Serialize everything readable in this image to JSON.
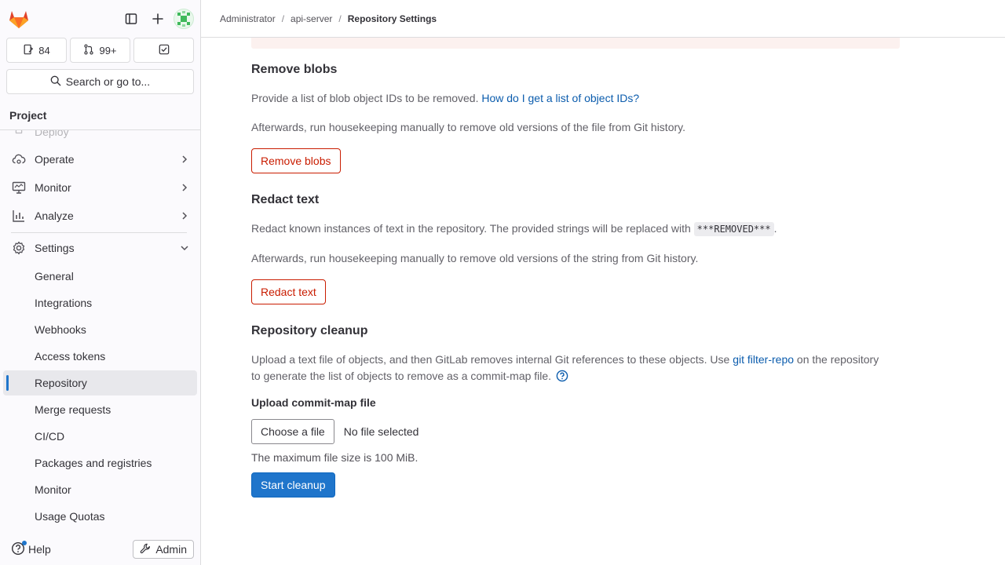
{
  "sidebar": {
    "counters": [
      {
        "icon": "issues-icon",
        "value": "84"
      },
      {
        "icon": "merge-request-icon",
        "value": "99+"
      },
      {
        "icon": "todo-icon",
        "value": ""
      }
    ],
    "search_label": "Search or go to...",
    "section_title": "Project",
    "nav": {
      "deploy": "Deploy",
      "operate": "Operate",
      "monitor": "Monitor",
      "analyze": "Analyze",
      "settings": "Settings"
    },
    "settings_items": [
      "General",
      "Integrations",
      "Webhooks",
      "Access tokens",
      "Repository",
      "Merge requests",
      "CI/CD",
      "Packages and registries",
      "Monitor",
      "Usage Quotas"
    ],
    "help_label": "Help",
    "admin_label": "Admin"
  },
  "breadcrumb": [
    "Administrator",
    "api-server",
    "Repository Settings"
  ],
  "remove_blobs": {
    "title": "Remove blobs",
    "description": "Provide a list of blob object IDs to be removed.",
    "help_link": "How do I get a list of object IDs?",
    "afterwards": "Afterwards, run housekeeping manually to remove old versions of the file from Git history.",
    "button": "Remove blobs"
  },
  "redact_text": {
    "title": "Redact text",
    "description": "Redact known instances of text in the repository. The provided strings will be replaced with",
    "code": "***REMOVED***",
    "period": ".",
    "afterwards": "Afterwards, run housekeeping manually to remove old versions of the string from Git history.",
    "button": "Redact text"
  },
  "cleanup": {
    "title": "Repository cleanup",
    "description_before": "Upload a text file of objects, and then GitLab removes internal Git references to these objects. Use",
    "link": "git filter-repo",
    "description_after": "on the repository to generate the list of objects to remove as a commit-map file.",
    "upload_label": "Upload commit-map file",
    "choose_file": "Choose a file",
    "no_file": "No file selected",
    "max_size": "The maximum file size is 100 MiB.",
    "start_button": "Start cleanup"
  },
  "colors": {
    "link": "#0b5cad",
    "danger": "#c91c00",
    "confirm": "#1f75cb"
  }
}
